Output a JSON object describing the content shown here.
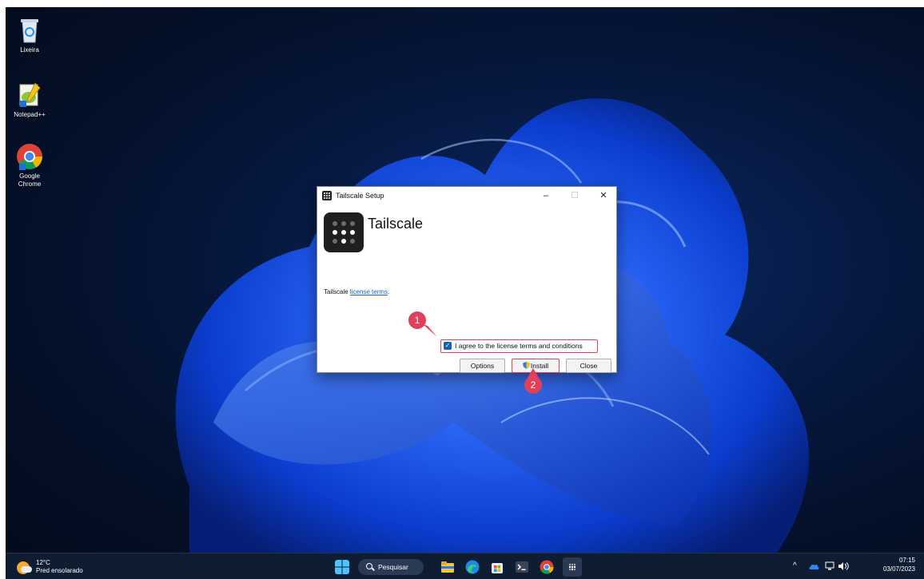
{
  "desktop": {
    "icons": [
      {
        "label": "Lixeira",
        "icon": "recycle-bin-icon"
      },
      {
        "label": "Notepad++",
        "icon": "notepad-plus-plus-icon"
      },
      {
        "label": "Google Chrome",
        "icon": "chrome-icon"
      }
    ]
  },
  "dialog": {
    "title": "Tailscale Setup",
    "minimize_glyph": "–",
    "maximize_glyph": "☐",
    "close_glyph": "✕",
    "product_name": "Tailscale",
    "license_prefix": "Tailscale",
    "license_link": "license terms",
    "license_suffix": ".",
    "agree_label": "I agree to the license terms and conditions",
    "agree_checked": true,
    "buttons": {
      "options": "Options",
      "install": "Install",
      "close": "Close"
    }
  },
  "annotations": {
    "step1": "1",
    "step2": "2",
    "color": "#e2405a"
  },
  "taskbar": {
    "weather": {
      "temp": "12°C",
      "condition": "Pred ensolarado"
    },
    "search_label": "Pesquisar",
    "pinned": [
      "windows-start-icon",
      "file-explorer-icon",
      "edge-icon",
      "microsoft-store-icon",
      "terminal-icon",
      "chrome-icon",
      "tailscale-icon"
    ],
    "tray": {
      "time": "07:15",
      "date": "03/07/2023"
    }
  },
  "colors": {
    "accent": "#1a5fb4",
    "taskbar": "#0f1d33",
    "wallpaper_bloom": "#1e5bff"
  }
}
